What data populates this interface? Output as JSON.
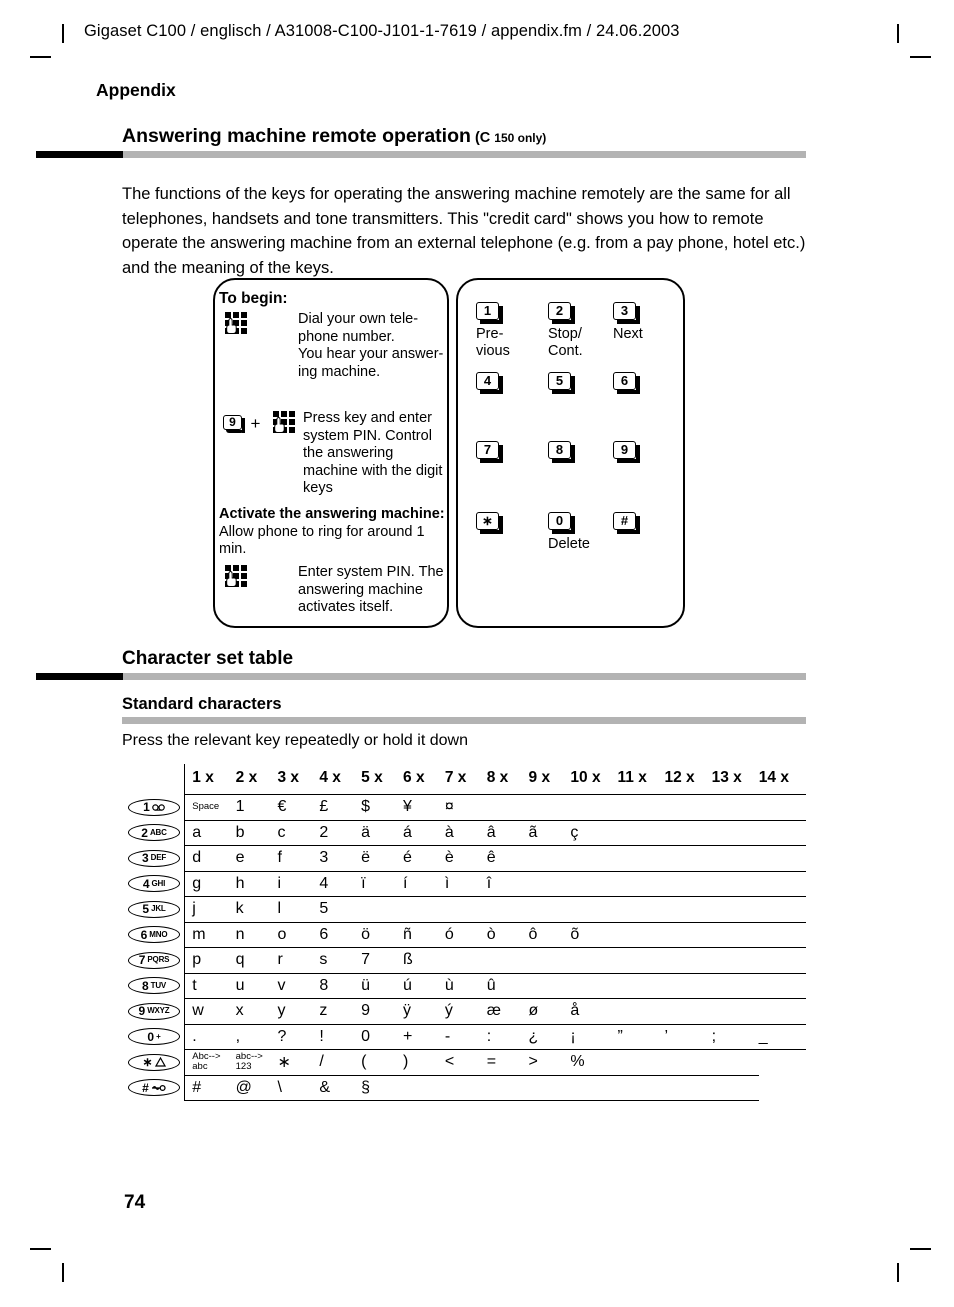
{
  "header": {
    "running_head": "Gigaset C100 / englisch / A31008-C100-J101-1-7619 / appendix.fm / 24.06.2003"
  },
  "page": {
    "section_title": "Appendix",
    "page_number": "74"
  },
  "remote_operation": {
    "heading": "Answering machine remote operation",
    "heading_suffix": "(C",
    "heading_suffix_small": "150 only)",
    "intro": "The functions of the keys for operating the answering machine remotely are the same for all telephones, handsets and tone transmitters. This \"credit card\" shows you how to remote operate the answering machine from an external telephone (e.g. from a pay phone, hotel etc.) and the meaning of the keys."
  },
  "card_left": {
    "to_begin": "To begin:",
    "step1_icon": "keypad-hand-icon",
    "step1_text": "Dial your own tele-phone number.\nYou hear your answer-ing machine.",
    "step2_key": "9",
    "step2_plus": "+",
    "step2_icon": "keypad-hand-icon",
    "step2_text": "Press key and enter system PIN. Control the answering machine with the digit keys",
    "activate_bold": "Activate the answering machine:",
    "activate_rest": " Allow phone to ring for around 1 min.",
    "step3_icon": "keypad-hand-icon",
    "step3_text": "Enter system PIN. The answering machine activates itself."
  },
  "card_right": {
    "keys": [
      {
        "key": "1",
        "label": "Pre-\nvious"
      },
      {
        "key": "2",
        "label": "Stop/\nCont."
      },
      {
        "key": "3",
        "label": "Next"
      },
      {
        "key": "4",
        "label": ""
      },
      {
        "key": "5",
        "label": ""
      },
      {
        "key": "6",
        "label": ""
      },
      {
        "key": "7",
        "label": ""
      },
      {
        "key": "8",
        "label": ""
      },
      {
        "key": "9",
        "label": ""
      },
      {
        "key": "∗",
        "label": ""
      },
      {
        "key": "0",
        "label": "Delete"
      },
      {
        "key": "#",
        "label": ""
      }
    ]
  },
  "charset": {
    "heading": "Character set table",
    "subheading": "Standard characters",
    "note": "Press the relevant key repeatedly or hold it down",
    "columns": [
      "1 x",
      "2 x",
      "3 x",
      "4 x",
      "5 x",
      "6 x",
      "7 x",
      "8 x",
      "9 x",
      "10 x",
      "11 x",
      "12 x",
      "13 x",
      "14 x"
    ],
    "rows": [
      {
        "key_num": "1",
        "key_letters": "",
        "key_icon": "voicemail-icon",
        "chars": [
          "Space",
          "1",
          "€",
          "£",
          "$",
          "¥",
          "¤",
          "",
          "",
          "",
          "",
          "",
          "",
          ""
        ],
        "tiny": [
          0
        ]
      },
      {
        "key_num": "2",
        "key_letters": "ABC",
        "key_icon": "",
        "chars": [
          "a",
          "b",
          "c",
          "2",
          "ä",
          "á",
          "à",
          "â",
          "ã",
          "ç",
          "",
          "",
          "",
          ""
        ],
        "tiny": []
      },
      {
        "key_num": "3",
        "key_letters": "DEF",
        "key_icon": "",
        "chars": [
          "d",
          "e",
          "f",
          "3",
          "ë",
          "é",
          "è",
          "ê",
          "",
          "",
          "",
          "",
          "",
          ""
        ],
        "tiny": []
      },
      {
        "key_num": "4",
        "key_letters": "GHI",
        "key_icon": "",
        "chars": [
          "g",
          "h",
          "i",
          "4",
          "ï",
          "í",
          "ì",
          "î",
          "",
          "",
          "",
          "",
          "",
          ""
        ],
        "tiny": []
      },
      {
        "key_num": "5",
        "key_letters": "JKL",
        "key_icon": "",
        "chars": [
          "j",
          "k",
          "l",
          "5",
          "",
          "",
          "",
          "",
          "",
          "",
          "",
          "",
          "",
          ""
        ],
        "tiny": []
      },
      {
        "key_num": "6",
        "key_letters": "MNO",
        "key_icon": "",
        "chars": [
          "m",
          "n",
          "o",
          "6",
          "ö",
          "ñ",
          "ó",
          "ò",
          "ô",
          "õ",
          "",
          "",
          "",
          ""
        ],
        "tiny": []
      },
      {
        "key_num": "7",
        "key_letters": "PQRS",
        "key_icon": "",
        "chars": [
          "p",
          "q",
          "r",
          "s",
          "7",
          "ß",
          "",
          "",
          "",
          "",
          "",
          "",
          "",
          ""
        ],
        "tiny": []
      },
      {
        "key_num": "8",
        "key_letters": "TUV",
        "key_icon": "",
        "chars": [
          "t",
          "u",
          "v",
          "8",
          "ü",
          "ú",
          "ù",
          "û",
          "",
          "",
          "",
          "",
          "",
          ""
        ],
        "tiny": []
      },
      {
        "key_num": "9",
        "key_letters": "WXYZ",
        "key_icon": "",
        "chars": [
          "w",
          "x",
          "y",
          "z",
          "9",
          "ÿ",
          "ý",
          "æ",
          "ø",
          "å",
          "",
          "",
          "",
          ""
        ],
        "tiny": []
      },
      {
        "key_num": "0",
        "key_letters": "+",
        "key_icon": "",
        "chars": [
          ".",
          ",",
          "?",
          "!",
          "0",
          "+",
          "-",
          ":",
          "¿",
          "¡",
          "”",
          "’",
          ";",
          "_"
        ],
        "tiny": []
      },
      {
        "key_num": "∗",
        "key_letters": "",
        "key_icon": "bell-icon",
        "chars": [
          "Abc-->\nabc",
          "abc-->\n123",
          "∗",
          "/",
          "(",
          ")",
          "<",
          "=",
          ">",
          "%",
          "",
          "",
          "",
          ""
        ],
        "tiny": [
          0,
          1
        ]
      },
      {
        "key_num": "#",
        "key_letters": "",
        "key_icon": "key-lock-icon",
        "chars": [
          "#",
          "@",
          "\\",
          "&",
          "§",
          "",
          "",
          "",
          "",
          "",
          "",
          "",
          ""
        ],
        "tiny": []
      }
    ]
  },
  "colors": {
    "rule_black": "#000000",
    "rule_gray": "#b3b3b3",
    "text": "#000000",
    "background": "#ffffff"
  }
}
